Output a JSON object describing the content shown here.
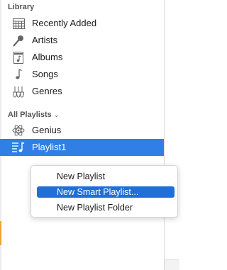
{
  "library": {
    "title": "Library",
    "items": [
      {
        "label": "Recently Added",
        "icon": "grid-calendar-icon"
      },
      {
        "label": "Artists",
        "icon": "microphone-icon"
      },
      {
        "label": "Albums",
        "icon": "album-icon"
      },
      {
        "label": "Songs",
        "icon": "music-note-icon"
      },
      {
        "label": "Genres",
        "icon": "guitars-icon"
      }
    ]
  },
  "playlists": {
    "title": "All Playlists",
    "chevron": "⌄",
    "items": [
      {
        "label": "Genius",
        "icon": "atom-icon"
      },
      {
        "label": "Playlist1",
        "icon": "playlist-icon",
        "selected": true
      }
    ]
  },
  "context_menu": {
    "items": [
      {
        "label": "New Playlist",
        "highlighted": false
      },
      {
        "label": "New Smart Playlist...",
        "highlighted": true
      },
      {
        "label": "New Playlist Folder",
        "highlighted": false
      }
    ]
  },
  "colors": {
    "selection": "#2f7fe6",
    "menu_highlight": "#1e6fd9"
  }
}
